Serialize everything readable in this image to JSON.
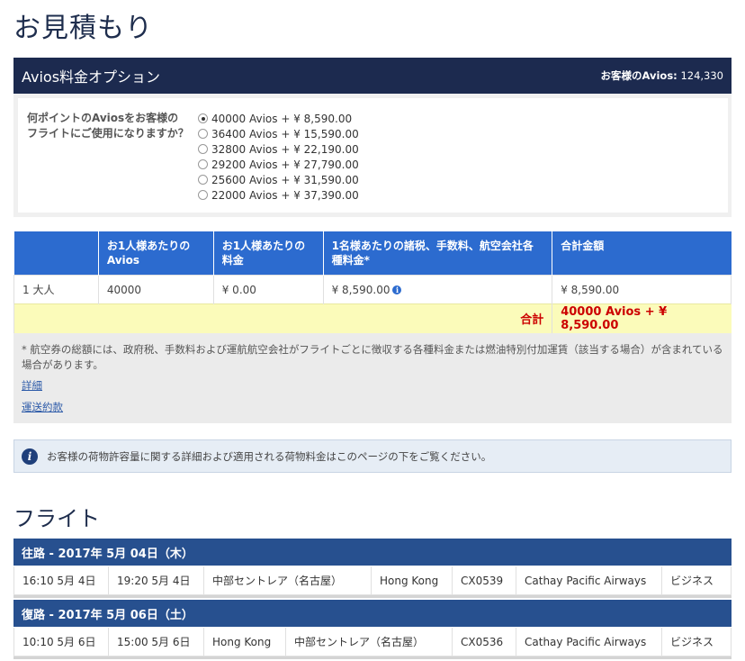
{
  "page_title": "お見積もり",
  "avios": {
    "title": "Avios料金オプション",
    "balance_label": "お客様のAvios:",
    "balance_value": "124,330",
    "question": "何ポイントのAviosをお客様のフライトにご使用になりますか？",
    "options": [
      {
        "label": "40000 Avios + ¥ 8,590.00",
        "selected": true
      },
      {
        "label": "36400 Avios + ¥ 15,590.00",
        "selected": false
      },
      {
        "label": "32800 Avios + ¥ 22,190.00",
        "selected": false
      },
      {
        "label": "29200 Avios + ¥ 27,790.00",
        "selected": false
      },
      {
        "label": "25600 Avios + ¥ 31,590.00",
        "selected": false
      },
      {
        "label": "22000 Avios + ¥ 37,390.00",
        "selected": false
      }
    ]
  },
  "price_table": {
    "headers": [
      "",
      "お1人様あたりのAvios",
      "お1人様あたりの料金",
      "1名様あたりの諸税、手数料、航空会社各種料金*",
      "合計金額"
    ],
    "rows": [
      [
        "1 大人",
        "40000",
        "¥ 0.00",
        "¥ 8,590.00",
        "¥ 8,590.00"
      ]
    ],
    "total_label": "合計",
    "total_value": "40000 Avios + ¥ 8,590.00"
  },
  "notes": {
    "text": "* 航空券の総額には、政府税、手数料および運航航空会社がフライトごとに徴収する各種料金または燃油特別付加運賃（該当する場合）が含まれている場合があります。",
    "link_details": "詳細",
    "link_terms": "運送約款"
  },
  "baggage_info": "お客様の荷物許容量に関する詳細および適用される荷物料金はこのページの下をご覧ください。",
  "flights_title": "フライト",
  "flights": [
    {
      "heading": "往路 - 2017年 5月 04日（木）",
      "cells": [
        "16:10 5月 4日",
        "19:20 5月 4日",
        "中部セントレア（名古屋）",
        "Hong Kong",
        "CX0539",
        "Cathay Pacific Airways",
        "ビジネス"
      ]
    },
    {
      "heading": "復路 - 2017年 5月 06日（土）",
      "cells": [
        "10:10 5月 6日",
        "15:00 5月 6日",
        "Hong Kong",
        "中部セントレア（名古屋）",
        "CX0536",
        "Cathay Pacific Airways",
        "ビジネス"
      ]
    }
  ],
  "colors": {
    "header_navy": "#1c2a4f",
    "table_blue": "#2c6bcf",
    "flight_blue": "#27508f",
    "total_red": "#cc0000",
    "total_bg": "#fbfbba"
  }
}
